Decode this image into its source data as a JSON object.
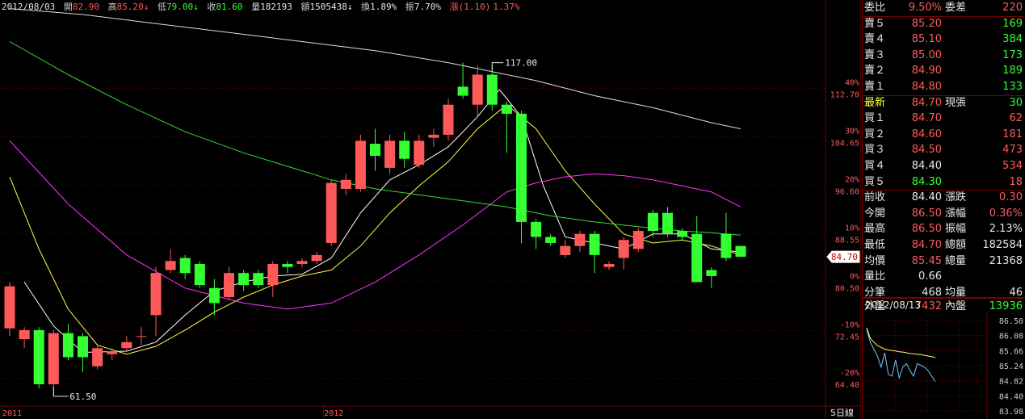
{
  "header": {
    "date": "2012/08/03",
    "open_label": "開",
    "open": "82.90",
    "high_label": "高",
    "high": "85.20",
    "low_label": "低",
    "low": "79.00",
    "close_label": "收",
    "close": "81.60",
    "vol_label": "量",
    "vol": "182193",
    "amt_label": "額",
    "amt": "1505438",
    "turn_label": "換",
    "turn": "1.89%",
    "amp_label": "振",
    "amp": "7.70%",
    "chg_label": "漲",
    "chg": "(1.10)",
    "chg_pct": "1.37%",
    "arrow_down": "↓"
  },
  "chart_data": {
    "type": "candlestick",
    "ylim": [
      60,
      125
    ],
    "y_ticks": [
      {
        "price": 112.7,
        "label": "112.70",
        "pct": "40%"
      },
      {
        "price": 104.65,
        "label": "104.65",
        "pct": "30%"
      },
      {
        "price": 96.6,
        "label": "96.60",
        "pct": "20%"
      },
      {
        "price": 88.55,
        "label": "88.55",
        "pct": "10%"
      },
      {
        "price": 80.5,
        "label": "80.50",
        "pct": "0%"
      },
      {
        "price": 72.45,
        "label": "72.45",
        "pct": "-10%"
      },
      {
        "price": 64.4,
        "label": "64.40",
        "pct": "-20%"
      }
    ],
    "x_labels": [
      {
        "index": 0,
        "label": "2011"
      },
      {
        "index": 22,
        "label": "2012"
      }
    ],
    "period_label": "5日線",
    "current_price": "84.70",
    "annotations": [
      {
        "index": 33,
        "price": 117.0,
        "label": "117.00"
      },
      {
        "index": 3,
        "price": 61.5,
        "label": "61.50"
      }
    ],
    "candles": [
      {
        "o": 72.8,
        "c": 79.8,
        "h": 80.5,
        "l": 71.5
      },
      {
        "o": 71.0,
        "c": 72.5,
        "h": 73.0,
        "l": 69.5
      },
      {
        "o": 72.5,
        "c": 63.5,
        "h": 73.0,
        "l": 62.8
      },
      {
        "o": 63.5,
        "c": 72.0,
        "h": 72.5,
        "l": 61.5
      },
      {
        "o": 72.0,
        "c": 68.0,
        "h": 73.5,
        "l": 67.5
      },
      {
        "o": 71.5,
        "c": 68.0,
        "h": 72.0,
        "l": 65.5
      },
      {
        "o": 66.5,
        "c": 69.5,
        "h": 70.0,
        "l": 66.0
      },
      {
        "o": 68.5,
        "c": 69.0,
        "h": 69.5,
        "l": 67.5
      },
      {
        "o": 69.5,
        "c": 70.5,
        "h": 71.5,
        "l": 69.0
      },
      {
        "o": 71.5,
        "c": 71.5,
        "h": 73.0,
        "l": 70.0
      },
      {
        "o": 75.0,
        "c": 82.0,
        "h": 83.0,
        "l": 71.5
      },
      {
        "o": 82.5,
        "c": 84.0,
        "h": 86.0,
        "l": 82.0
      },
      {
        "o": 84.5,
        "c": 82.0,
        "h": 85.0,
        "l": 81.0
      },
      {
        "o": 83.5,
        "c": 80.0,
        "h": 84.0,
        "l": 79.5
      },
      {
        "o": 79.5,
        "c": 77.0,
        "h": 81.0,
        "l": 75.0
      },
      {
        "o": 78.0,
        "c": 82.0,
        "h": 83.0,
        "l": 77.5
      },
      {
        "o": 82.0,
        "c": 80.0,
        "h": 82.5,
        "l": 79.0
      },
      {
        "o": 82.0,
        "c": 80.0,
        "h": 82.5,
        "l": 79.5
      },
      {
        "o": 80.0,
        "c": 83.5,
        "h": 84.0,
        "l": 78.0
      },
      {
        "o": 83.5,
        "c": 83.0,
        "h": 84.0,
        "l": 82.0
      },
      {
        "o": 83.5,
        "c": 84.0,
        "h": 84.5,
        "l": 83.0
      },
      {
        "o": 84.0,
        "c": 85.0,
        "h": 85.5,
        "l": 83.5
      },
      {
        "o": 87.0,
        "c": 97.0,
        "h": 97.5,
        "l": 86.5
      },
      {
        "o": 96.0,
        "c": 97.5,
        "h": 98.5,
        "l": 95.0
      },
      {
        "o": 96.0,
        "c": 104.0,
        "h": 105.0,
        "l": 95.5
      },
      {
        "o": 103.5,
        "c": 101.5,
        "h": 106.0,
        "l": 99.0
      },
      {
        "o": 99.5,
        "c": 104.0,
        "h": 105.0,
        "l": 98.5
      },
      {
        "o": 104.0,
        "c": 101.0,
        "h": 105.5,
        "l": 99.5
      },
      {
        "o": 100.0,
        "c": 104.0,
        "h": 105.0,
        "l": 99.5
      },
      {
        "o": 104.5,
        "c": 105.0,
        "h": 106.0,
        "l": 103.0
      },
      {
        "o": 105.0,
        "c": 110.0,
        "h": 111.0,
        "l": 104.0
      },
      {
        "o": 113.0,
        "c": 111.5,
        "h": 117.0,
        "l": 111.0
      },
      {
        "o": 110.0,
        "c": 115.0,
        "h": 116.5,
        "l": 108.0
      },
      {
        "o": 115.0,
        "c": 110.0,
        "h": 116.5,
        "l": 109.0
      },
      {
        "o": 110.0,
        "c": 108.5,
        "h": 110.5,
        "l": 102.0
      },
      {
        "o": 108.5,
        "c": 90.5,
        "h": 109.0,
        "l": 87.0
      },
      {
        "o": 90.5,
        "c": 88.0,
        "h": 91.0,
        "l": 86.0
      },
      {
        "o": 88.0,
        "c": 87.0,
        "h": 88.5,
        "l": 86.5
      },
      {
        "o": 85.0,
        "c": 86.5,
        "h": 87.5,
        "l": 84.5
      },
      {
        "o": 86.5,
        "c": 88.5,
        "h": 89.0,
        "l": 85.5
      },
      {
        "o": 88.5,
        "c": 85.0,
        "h": 89.0,
        "l": 82.0
      },
      {
        "o": 83.0,
        "c": 83.5,
        "h": 84.0,
        "l": 82.5
      },
      {
        "o": 84.5,
        "c": 87.5,
        "h": 88.0,
        "l": 82.5
      },
      {
        "o": 86.0,
        "c": 89.0,
        "h": 89.5,
        "l": 85.5
      },
      {
        "o": 92.0,
        "c": 89.0,
        "h": 92.5,
        "l": 88.0
      },
      {
        "o": 92.0,
        "c": 88.5,
        "h": 93.0,
        "l": 88.0
      },
      {
        "o": 89.0,
        "c": 88.0,
        "h": 89.5,
        "l": 87.5
      },
      {
        "o": 88.5,
        "c": 80.5,
        "h": 91.5,
        "l": 80.5
      },
      {
        "o": 82.5,
        "c": 81.5,
        "h": 83.0,
        "l": 79.5
      },
      {
        "o": 88.5,
        "c": 84.5,
        "h": 92.0,
        "l": 84.0
      },
      {
        "o": 86.5,
        "c": 84.7,
        "h": 86.5,
        "l": 84.7
      }
    ],
    "series": [
      {
        "color": "#ffffff",
        "values": [
          [
            1,
            80.5
          ],
          [
            3,
            73.2
          ],
          [
            5,
            68.8
          ],
          [
            8,
            69.0
          ],
          [
            10,
            70.5
          ],
          [
            12,
            75.0
          ],
          [
            14,
            79.0
          ],
          [
            16,
            80.5
          ],
          [
            18,
            81.5
          ],
          [
            20,
            81.8
          ],
          [
            22,
            84.5
          ],
          [
            24,
            92.0
          ],
          [
            26,
            97.5
          ],
          [
            28,
            100.0
          ],
          [
            30,
            103.0
          ],
          [
            32,
            108.0
          ],
          [
            33.5,
            112.5
          ],
          [
            35,
            108.0
          ],
          [
            36.5,
            96.5
          ],
          [
            38,
            88.0
          ],
          [
            40,
            87.0
          ],
          [
            42,
            86.0
          ],
          [
            44,
            88.5
          ],
          [
            46,
            88.5
          ],
          [
            48,
            86.0
          ],
          [
            50,
            85.5
          ]
        ]
      },
      {
        "color": "#ffff44",
        "values": [
          [
            0,
            98.0
          ],
          [
            2,
            86.0
          ],
          [
            4,
            76.0
          ],
          [
            6,
            70.0
          ],
          [
            8,
            68.5
          ],
          [
            10,
            69.8
          ],
          [
            12,
            72.5
          ],
          [
            14,
            75.5
          ],
          [
            16,
            78.0
          ],
          [
            18,
            80.0
          ],
          [
            20,
            81.5
          ],
          [
            22,
            82.5
          ],
          [
            24,
            86.5
          ],
          [
            26,
            92.0
          ],
          [
            28,
            96.5
          ],
          [
            30,
            100.5
          ],
          [
            32,
            106.0
          ],
          [
            34,
            110.0
          ],
          [
            36,
            106.0
          ],
          [
            38,
            99.0
          ],
          [
            40,
            93.5
          ],
          [
            42,
            88.5
          ],
          [
            44,
            87.0
          ],
          [
            46,
            87.5
          ],
          [
            48,
            86.5
          ],
          [
            50,
            85.0
          ]
        ]
      },
      {
        "color": "#ff33ff",
        "values": [
          [
            0,
            104.0
          ],
          [
            4,
            93.5
          ],
          [
            8,
            85.0
          ],
          [
            12,
            79.5
          ],
          [
            16,
            77.0
          ],
          [
            19,
            76.0
          ],
          [
            22,
            77.0
          ],
          [
            25,
            80.5
          ],
          [
            28,
            85.0
          ],
          [
            31,
            90.0
          ],
          [
            34,
            95.5
          ],
          [
            36,
            97.0
          ],
          [
            38,
            98.0
          ],
          [
            40,
            98.5
          ],
          [
            42,
            98.2
          ],
          [
            44,
            97.5
          ],
          [
            46,
            96.5
          ],
          [
            48,
            95.5
          ],
          [
            50,
            93.0
          ]
        ]
      },
      {
        "color": "#33dd33",
        "values": [
          [
            0,
            120.5
          ],
          [
            4,
            115.0
          ],
          [
            8,
            110.0
          ],
          [
            12,
            105.5
          ],
          [
            16,
            102.0
          ],
          [
            20,
            99.0
          ],
          [
            22,
            97.5
          ],
          [
            25,
            96.0
          ],
          [
            28,
            95.0
          ],
          [
            31,
            94.0
          ],
          [
            34,
            93.0
          ],
          [
            37,
            91.5
          ],
          [
            40,
            90.5
          ],
          [
            43,
            89.7
          ],
          [
            46,
            89.0
          ],
          [
            48,
            88.7
          ],
          [
            50,
            88.3
          ]
        ]
      },
      {
        "color": "#dddddd",
        "values": [
          [
            0,
            126.0
          ],
          [
            5,
            125.0
          ],
          [
            10,
            123.5
          ],
          [
            15,
            122.0
          ],
          [
            20,
            120.5
          ],
          [
            25,
            119.0
          ],
          [
            30,
            117.0
          ],
          [
            33,
            115.5
          ],
          [
            36,
            114.0
          ],
          [
            40,
            111.5
          ],
          [
            44,
            109.5
          ],
          [
            48,
            107.0
          ],
          [
            50,
            106.0
          ]
        ]
      }
    ]
  },
  "quote": {
    "rows": [
      {
        "cells": [
          [
            "委比",
            "w"
          ],
          [
            "9.50%",
            "r"
          ],
          [
            "委差",
            "w"
          ],
          [
            "220",
            "r"
          ]
        ]
      },
      {
        "cells": [
          [
            "賣５",
            "w"
          ],
          [
            "85.20",
            "r"
          ],
          [
            "",
            "w"
          ],
          [
            "169",
            "g"
          ]
        ]
      },
      {
        "cells": [
          [
            "賣４",
            "w"
          ],
          [
            "85.10",
            "r"
          ],
          [
            "",
            "w"
          ],
          [
            "384",
            "g"
          ]
        ]
      },
      {
        "cells": [
          [
            "賣３",
            "w"
          ],
          [
            "85.00",
            "r"
          ],
          [
            "",
            "w"
          ],
          [
            "173",
            "g"
          ]
        ]
      },
      {
        "cells": [
          [
            "賣２",
            "w"
          ],
          [
            "84.90",
            "r"
          ],
          [
            "",
            "w"
          ],
          [
            "189",
            "g"
          ]
        ]
      },
      {
        "cells": [
          [
            "賣１",
            "w"
          ],
          [
            "84.80",
            "r"
          ],
          [
            "",
            "w"
          ],
          [
            "133",
            "g"
          ]
        ]
      },
      {
        "cells": [
          [
            "最新",
            "y"
          ],
          [
            "84.70",
            "r"
          ],
          [
            "現張",
            "w"
          ],
          [
            "30",
            "g"
          ]
        ]
      },
      {
        "cells": [
          [
            "買１",
            "w"
          ],
          [
            "84.70",
            "r"
          ],
          [
            "",
            "w"
          ],
          [
            "62",
            "r"
          ]
        ]
      },
      {
        "cells": [
          [
            "買２",
            "w"
          ],
          [
            "84.60",
            "r"
          ],
          [
            "",
            "w"
          ],
          [
            "181",
            "r"
          ]
        ]
      },
      {
        "cells": [
          [
            "買３",
            "w"
          ],
          [
            "84.50",
            "r"
          ],
          [
            "",
            "w"
          ],
          [
            "473",
            "r"
          ]
        ]
      },
      {
        "cells": [
          [
            "買４",
            "w"
          ],
          [
            "84.40",
            "w"
          ],
          [
            "",
            "w"
          ],
          [
            "534",
            "r"
          ]
        ]
      },
      {
        "cells": [
          [
            "買５",
            "w"
          ],
          [
            "84.30",
            "g"
          ],
          [
            "",
            "w"
          ],
          [
            "18",
            "r"
          ]
        ]
      },
      {
        "cells": [
          [
            "前收",
            "w"
          ],
          [
            "84.40",
            "w"
          ],
          [
            "漲跌",
            "w"
          ],
          [
            "0.30",
            "r"
          ]
        ]
      },
      {
        "cells": [
          [
            "今開",
            "w"
          ],
          [
            "86.50",
            "r"
          ],
          [
            "漲幅",
            "w"
          ],
          [
            "0.36%",
            "r"
          ]
        ]
      },
      {
        "cells": [
          [
            "最高",
            "w"
          ],
          [
            "86.50",
            "r"
          ],
          [
            "振幅",
            "w"
          ],
          [
            "2.13%",
            "w"
          ]
        ]
      },
      {
        "cells": [
          [
            "最低",
            "w"
          ],
          [
            "84.70",
            "r"
          ],
          [
            "總額",
            "w"
          ],
          [
            "182584",
            "w"
          ]
        ]
      },
      {
        "cells": [
          [
            "均價",
            "w"
          ],
          [
            "85.45",
            "r"
          ],
          [
            "總量",
            "w"
          ],
          [
            "21368",
            "w"
          ]
        ]
      },
      {
        "cells": [
          [
            "量比",
            "w"
          ],
          [
            "0.66",
            "w"
          ],
          [
            "",
            "w"
          ],
          [
            "",
            "w"
          ]
        ]
      },
      {
        "cells": [
          [
            "分筆",
            "w"
          ],
          [
            "468",
            "w"
          ],
          [
            "均量",
            "w"
          ],
          [
            "46",
            "w"
          ]
        ]
      }
    ],
    "footer": {
      "outer_label": "外盤",
      "outer": "7432",
      "inner_label": "內盤",
      "inner": "13936"
    }
  },
  "mini_chart": {
    "date": "2012/08/13",
    "ylim": [
      83.98,
      86.5
    ],
    "y_ticks": [
      "86.50",
      "86.08",
      "85.66",
      "85.24",
      "84.82",
      "84.40",
      "83.98"
    ],
    "price_line": [
      86.25,
      85.9,
      85.7,
      85.5,
      85.2,
      85.6,
      85.0,
      84.95,
      85.4,
      84.9,
      85.2,
      85.3,
      85.1,
      84.95,
      85.3,
      85.25,
      85.2,
      85.1,
      84.95,
      84.8
    ],
    "avg_line": [
      86.3,
      86.0,
      85.9,
      85.8,
      85.75,
      85.7,
      85.68,
      85.66,
      85.65,
      85.63,
      85.62,
      85.6,
      85.58,
      85.57,
      85.56,
      85.55,
      85.53,
      85.51,
      85.49,
      85.47
    ]
  },
  "colors": {
    "up": "#ff5a5a",
    "down": "#33ff33",
    "grid": "#7a0000",
    "axis_text": "#ff5a5a"
  }
}
